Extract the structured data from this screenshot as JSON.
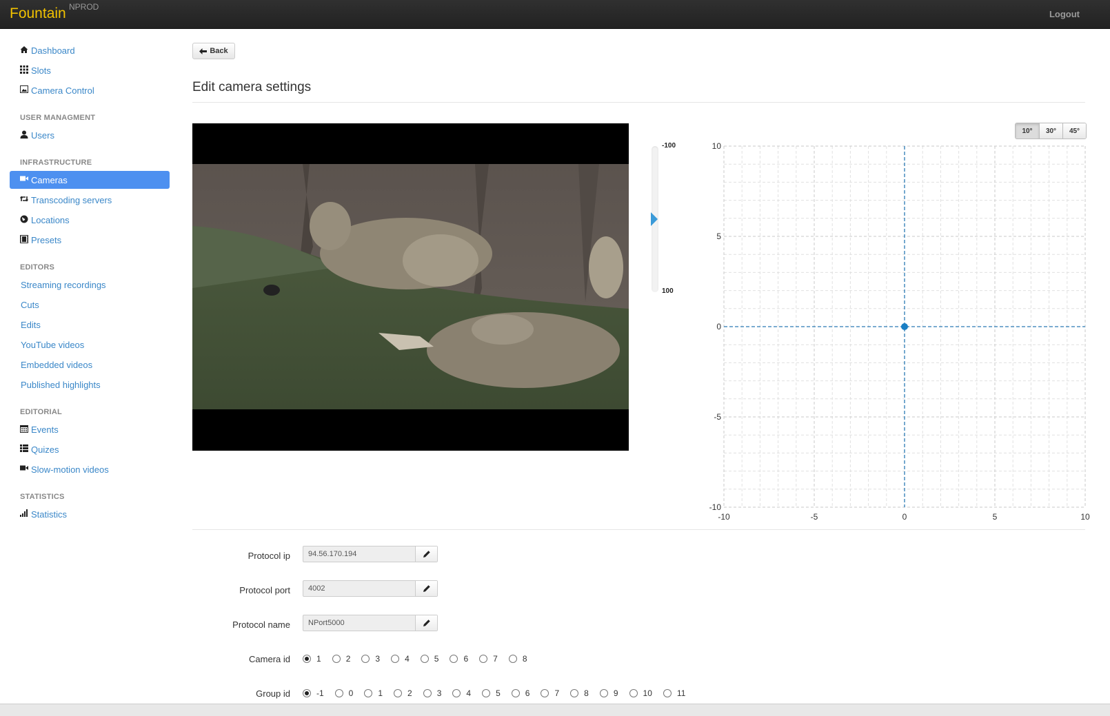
{
  "navbar": {
    "brand": "Fountain",
    "environment": "NPROD",
    "logout": "Logout"
  },
  "sidebar": {
    "top": [
      {
        "label": "Dashboard",
        "icon": "home-icon"
      },
      {
        "label": "Slots",
        "icon": "grid-icon"
      },
      {
        "label": "Camera Control",
        "icon": "image-icon"
      }
    ],
    "user_header": "USER MANAGMENT",
    "user_items": [
      {
        "label": "Users",
        "icon": "user-icon"
      }
    ],
    "infra_header": "INFRASTRUCTURE",
    "infra_items": [
      {
        "label": "Cameras",
        "icon": "video-camera-icon"
      },
      {
        "label": "Transcoding servers",
        "icon": "retweet-icon"
      },
      {
        "label": "Locations",
        "icon": "globe-icon"
      },
      {
        "label": "Presets",
        "icon": "film-icon"
      }
    ],
    "editors_header": "EDITORS",
    "editors_items": [
      {
        "label": "Streaming recordings"
      },
      {
        "label": "Cuts"
      },
      {
        "label": "Edits"
      },
      {
        "label": "YouTube videos"
      },
      {
        "label": "Embedded videos"
      },
      {
        "label": "Published highlights"
      }
    ],
    "editorial_header": "EDITORIAL",
    "editorial_items": [
      {
        "label": "Events",
        "icon": "calendar-icon"
      },
      {
        "label": "Quizes",
        "icon": "list-icon"
      },
      {
        "label": "Slow-motion videos",
        "icon": "video-camera-icon"
      }
    ],
    "statistics_header": "STATISTICS",
    "statistics_items": [
      {
        "label": "Statistics",
        "icon": "signal-icon"
      }
    ]
  },
  "back_label": "Back",
  "page_title": "Edit camera settings",
  "zoom": {
    "top_label": "-100",
    "bottom_label": "100",
    "value": 0
  },
  "angles": [
    "10°",
    "30°",
    "45°"
  ],
  "angle_selected": "10°",
  "chart_data": {
    "type": "scatter",
    "xlim": [
      -10,
      10
    ],
    "ylim": [
      -10,
      10
    ],
    "x_ticks": [
      "-10",
      "-5",
      "0",
      "5",
      "10"
    ],
    "y_ticks": [
      "10",
      "5",
      "0",
      "-5",
      "-10"
    ],
    "points": [
      {
        "x": 0,
        "y": 0
      }
    ],
    "grid": true,
    "crosshair": true,
    "colors": {
      "point": "#1a7fc4",
      "crosshair": "#2a79b3",
      "grid": "#c8c8c8"
    }
  },
  "form": {
    "protocol_ip": {
      "label": "Protocol ip",
      "value": "94.56.170.194"
    },
    "protocol_port": {
      "label": "Protocol port",
      "value": "4002"
    },
    "protocol_name": {
      "label": "Protocol name",
      "value": "NPort5000"
    },
    "camera_id": {
      "label": "Camera id",
      "options": [
        "1",
        "2",
        "3",
        "4",
        "5",
        "6",
        "7",
        "8"
      ],
      "selected": "1"
    },
    "group_id": {
      "label": "Group id",
      "options": [
        "-1",
        "0",
        "1",
        "2",
        "3",
        "4",
        "5",
        "6",
        "7",
        "8",
        "9",
        "10",
        "11"
      ],
      "selected": "-1"
    }
  }
}
